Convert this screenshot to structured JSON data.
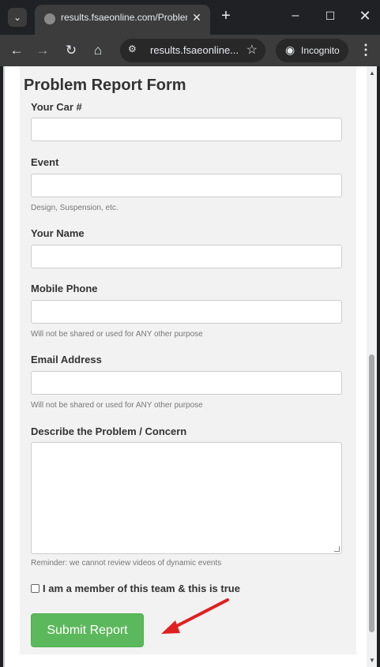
{
  "browser": {
    "tab_title": "results.fsaeonline.com/Problem",
    "url": "results.fsaeonline...",
    "incognito_label": "Incognito"
  },
  "form": {
    "title": "Problem Report Form",
    "fields": [
      {
        "label": "Your Car #",
        "value": "",
        "help": ""
      },
      {
        "label": "Event",
        "value": "",
        "help": "Design, Suspension, etc."
      },
      {
        "label": "Your Name",
        "value": "",
        "help": ""
      },
      {
        "label": "Mobile Phone",
        "value": "",
        "help": "Will not be shared or used for ANY other purpose"
      },
      {
        "label": "Email Address",
        "value": "",
        "help": "Will not be shared or used for ANY other purpose"
      },
      {
        "label": "Describe the Problem / Concern",
        "value": "",
        "help": "Reminder: we cannot review videos of dynamic events"
      }
    ],
    "checkbox_label": "I am a member of this team & this is true",
    "checkbox_checked": false,
    "submit_label": "Submit Report"
  },
  "colors": {
    "submit_bg": "#5cb85c",
    "annotation_arrow": "#e02020",
    "chrome_bg": "#202124",
    "toolbar_bg": "#3c3c3c"
  },
  "icons": [
    "tab-search-icon",
    "globe-icon",
    "close-icon",
    "plus-icon",
    "minimize-icon",
    "maximize-icon",
    "back-icon",
    "forward-icon",
    "reload-icon",
    "home-icon",
    "site-info-icon",
    "star-icon",
    "incognito-icon",
    "kebab-menu-icon"
  ]
}
